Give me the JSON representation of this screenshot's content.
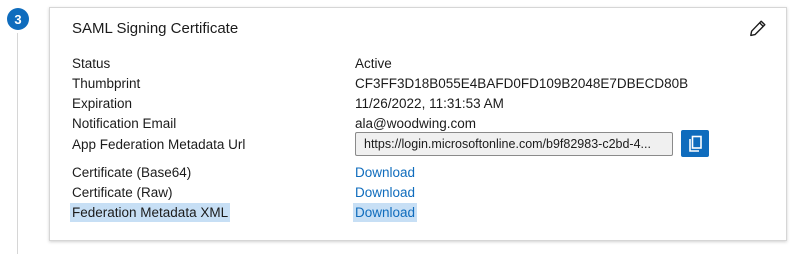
{
  "step": {
    "number": "3"
  },
  "card": {
    "title": "SAML Signing Certificate",
    "edit_icon": "pencil-icon"
  },
  "fields": {
    "status": {
      "label": "Status",
      "value": "Active"
    },
    "thumbprint": {
      "label": "Thumbprint",
      "value": "CF3FF3D18B055E4BAFD0FD109B2048E7DBECD80B"
    },
    "expiration": {
      "label": "Expiration",
      "value": "11/26/2022, 11:31:53 AM"
    },
    "notification_email": {
      "label": "Notification Email",
      "value": "ala@woodwing.com"
    },
    "metadata_url": {
      "label": "App Federation Metadata Url",
      "value": "https://login.microsoftonline.com/b9f82983-c2bd-4...",
      "copy_icon": "copy-icon"
    }
  },
  "downloads": [
    {
      "label": "Certificate (Base64)",
      "link": "Download"
    },
    {
      "label": "Certificate (Raw)",
      "link": "Download"
    },
    {
      "label": "Federation Metadata XML",
      "link": "Download"
    }
  ],
  "colors": {
    "accent": "#0f6cbd",
    "highlight": "#c7dff5",
    "border": "#d6d6d6"
  }
}
